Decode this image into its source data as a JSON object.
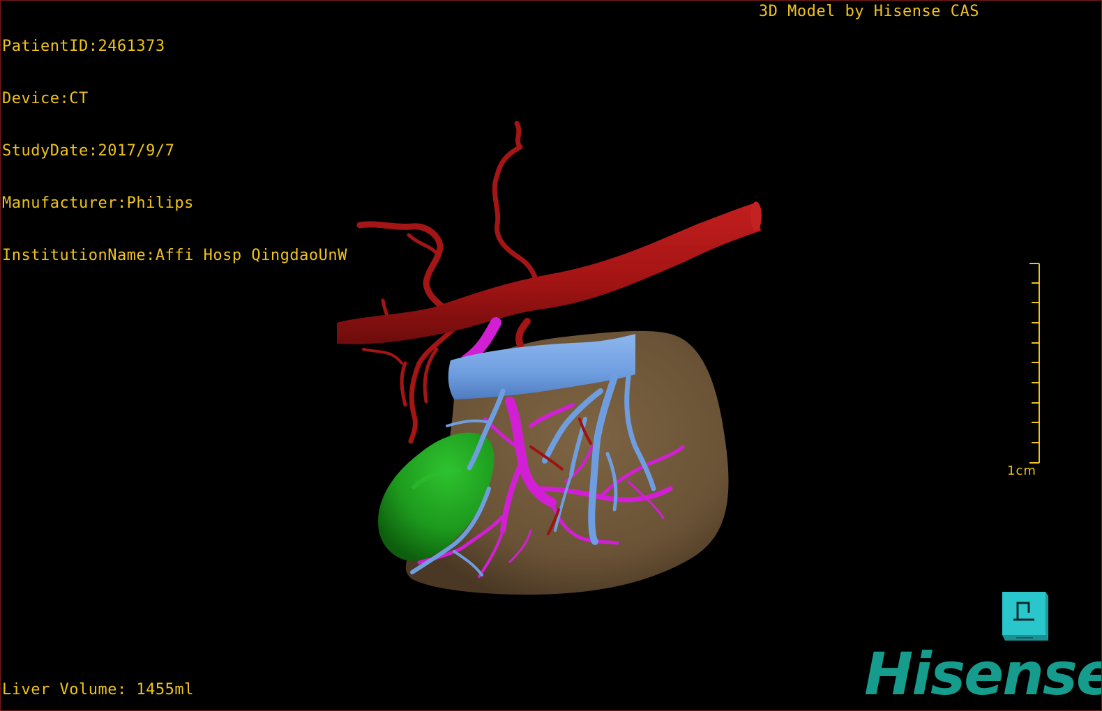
{
  "dicom_info": {
    "patient_id": "PatientID:2461373",
    "device": "Device:CT",
    "study_date": "StudyDate:2017/9/7",
    "manufacturer": "Manufacturer:Philips",
    "institution": "InstitutionName:Affi Hosp QingdaoUnW"
  },
  "model_credit": "3D Model by Hisense CAS",
  "liver_volume": "Liver Volume: 1455ml",
  "scale": {
    "label": "1cm"
  },
  "orientation_cube": {
    "face_label": "P"
  },
  "brand": {
    "logo_text": "Hisense"
  },
  "colors": {
    "overlay_text": "#f0c419",
    "liver": "#6f5638",
    "artery": "#b0171a",
    "portal_vein": "#d21fd6",
    "hepatic_vein": "#6f9ee0",
    "gallbladder": "#1d9a1d",
    "brand": "#169c8c",
    "cube": "#29c6cc"
  }
}
